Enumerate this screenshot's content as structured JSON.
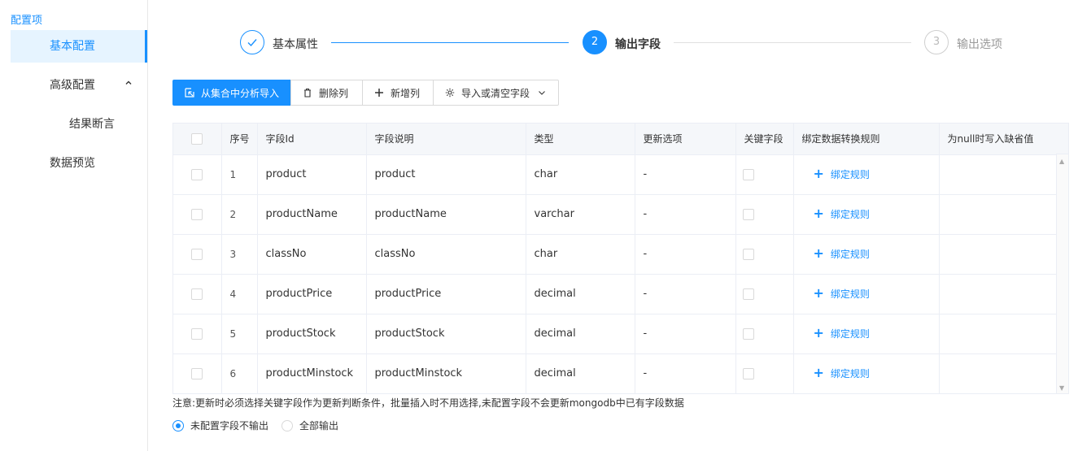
{
  "sidebar": {
    "title": "配置项",
    "items": [
      {
        "label": "基本配置",
        "active": true
      },
      {
        "label": "高级配置",
        "expanded": true
      },
      {
        "label": "结果断言"
      },
      {
        "label": "数据预览"
      }
    ]
  },
  "steps": [
    {
      "number": "✓",
      "label": "基本属性",
      "status": "finish"
    },
    {
      "number": "2",
      "label": "输出字段",
      "status": "process"
    },
    {
      "number": "3",
      "label": "输出选项",
      "status": "wait"
    }
  ],
  "toolbar": {
    "import_label": "从集合中分析导入",
    "delete_label": "删除列",
    "add_label": "新增列",
    "import_clear_label": "导入或清空字段"
  },
  "table": {
    "columns": [
      "序号",
      "字段Id",
      "字段说明",
      "类型",
      "更新选项",
      "关键字段",
      "绑定数据转换规则",
      "为null时写入缺省值"
    ],
    "rows": [
      {
        "no": "1",
        "id": "product",
        "desc": "product",
        "type": "char",
        "update": "-",
        "bind": "绑定规则"
      },
      {
        "no": "2",
        "id": "productName",
        "desc": "productName",
        "type": "varchar",
        "update": "-",
        "bind": "绑定规则"
      },
      {
        "no": "3",
        "id": "classNo",
        "desc": "classNo",
        "type": "char",
        "update": "-",
        "bind": "绑定规则"
      },
      {
        "no": "4",
        "id": "productPrice",
        "desc": "productPrice",
        "type": "decimal",
        "update": "-",
        "bind": "绑定规则"
      },
      {
        "no": "5",
        "id": "productStock",
        "desc": "productStock",
        "type": "decimal",
        "update": "-",
        "bind": "绑定规则"
      },
      {
        "no": "6",
        "id": "productMinstock",
        "desc": "productMinstock",
        "type": "decimal",
        "update": "-",
        "bind": "绑定规则"
      }
    ]
  },
  "note": "注意:更新时必须选择关键字段作为更新判断条件，批量插入时不用选择,未配置字段不会更新mongodb中已有字段数据",
  "output_mode": {
    "options": [
      "未配置字段不输出",
      "全部输出"
    ],
    "selected": 0
  },
  "colors": {
    "accent": "#1890ff",
    "border": "#d9d9d9",
    "header_bg": "#f5f7fa"
  }
}
